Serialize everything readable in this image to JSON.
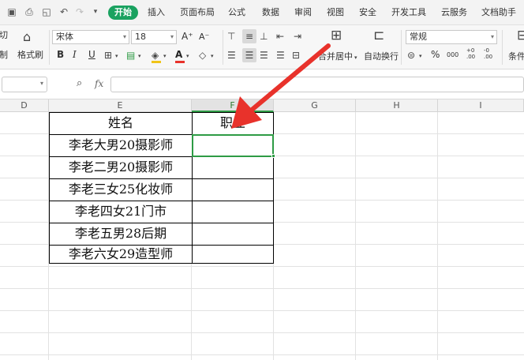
{
  "menubar": {
    "start_tab": "开始",
    "tabs": [
      "插入",
      "页面布局",
      "公式",
      "数据",
      "审阅",
      "视图",
      "安全",
      "开发工具",
      "云服务",
      "文档助手"
    ]
  },
  "ribbon": {
    "cut_label": "剪切",
    "copy_label": "复制",
    "format_painter_label": "格式刷",
    "font_name": "宋体",
    "font_size": "18",
    "grow_font": "A⁺",
    "shrink_font": "A⁻",
    "bold": "B",
    "italic": "I",
    "underline": "U",
    "merge_center_label": "合并居中",
    "wrap_text_label": "自动换行",
    "number_format": "常规",
    "percent": "%",
    "thousands": "000",
    "inc_decimal": "+0 .00",
    "dec_decimal": "-0 .00",
    "conditional_format_label": "条件"
  },
  "formula_bar": {
    "namebox_value": "",
    "fx_label": "fx",
    "formula_value": ""
  },
  "columns": [
    "D",
    "E",
    "F",
    "G",
    "H",
    "I"
  ],
  "selected_column": "F",
  "table": {
    "headers": [
      "姓名",
      "职业"
    ],
    "rows": [
      [
        "李老大男20摄影师",
        ""
      ],
      [
        "李老二男20摄影师",
        ""
      ],
      [
        "李老三女25化妆师",
        ""
      ],
      [
        "李老四女21门市",
        ""
      ],
      [
        "李老五男28后期",
        ""
      ],
      [
        "李老六女29造型师",
        ""
      ]
    ]
  },
  "colors": {
    "accent_green": "#1aa260",
    "selection_green": "#2e9b45",
    "arrow_red": "#e8322b"
  }
}
